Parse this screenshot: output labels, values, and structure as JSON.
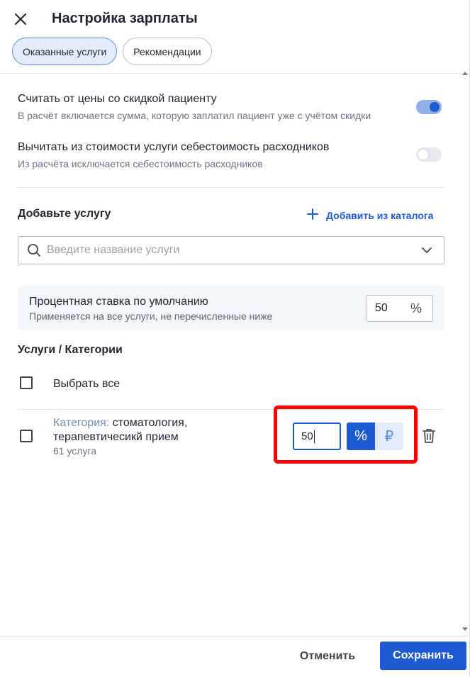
{
  "header": {
    "title": "Настройка зарплаты",
    "close_icon": "close-icon"
  },
  "tabs": [
    {
      "label": "Оказанные услуги",
      "active": true
    },
    {
      "label": "Рекомендации",
      "active": false
    }
  ],
  "settings": [
    {
      "title": "Считать от цены со скидкой пациенту",
      "description": "В расчёт включается сумма, которую заплатил пациент уже с учётом скидки",
      "enabled": true
    },
    {
      "title": "Вычитать из стоимости услуги себестоимость расходников",
      "description": "Из расчёта исключается себестоимость расходников",
      "enabled": false
    }
  ],
  "add_service": {
    "label": "Добавьте услугу",
    "catalog_link": "Добавить из каталога",
    "search_placeholder": "Введите название услуги"
  },
  "default_rate": {
    "title": "Процентная ставка по умолчанию",
    "description": "Применяется на все услуги, не перечисленные ниже",
    "value": "50",
    "unit": "%"
  },
  "services": {
    "title": "Услуги / Категории",
    "select_all": "Выбрать все",
    "rows": [
      {
        "prefix": "Категория:",
        "name_line1": "стоматология,",
        "name_line2": "терапевтичесикй прием",
        "count": "61 услуга",
        "value": "50",
        "unit_percent": "%",
        "unit_rub": "₽",
        "selected_unit": "percent"
      }
    ]
  },
  "footer": {
    "cancel": "Отменить",
    "save": "Сохранить"
  },
  "colors": {
    "accent": "#1f5bd0",
    "highlight": "#ff0000"
  }
}
